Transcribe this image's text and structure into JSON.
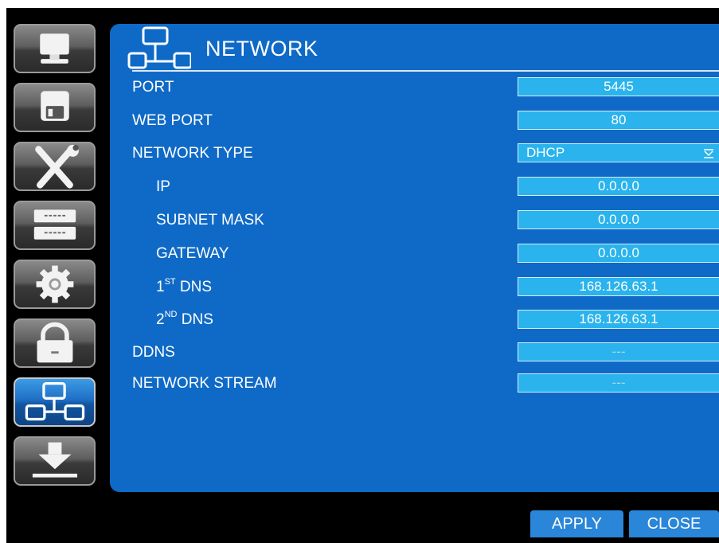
{
  "window": {
    "title": "NETWORK"
  },
  "sidebar": {
    "items": [
      {
        "name": "display",
        "icon": "monitor-icon"
      },
      {
        "name": "record",
        "icon": "floppy-disk-icon"
      },
      {
        "name": "devices",
        "icon": "tools-icon"
      },
      {
        "name": "storage",
        "icon": "hard-drive-icon"
      },
      {
        "name": "system",
        "icon": "gear-icon"
      },
      {
        "name": "security",
        "icon": "lock-icon"
      },
      {
        "name": "network",
        "icon": "network-icon",
        "active": true
      },
      {
        "name": "backup",
        "icon": "download-icon"
      }
    ]
  },
  "rows": {
    "port": {
      "label": "PORT",
      "value": "5445"
    },
    "web_port": {
      "label": "WEB PORT",
      "value": "80"
    },
    "network_type": {
      "label": "NETWORK TYPE",
      "value": "DHCP"
    },
    "ip": {
      "label": "IP",
      "value": "0.0.0.0"
    },
    "subnet_mask": {
      "label": "SUBNET MASK",
      "value": "0.0.0.0"
    },
    "gateway": {
      "label": "GATEWAY",
      "value": "0.0.0.0"
    },
    "dns1": {
      "label_num": "1",
      "label_sup": "ST",
      "label_rest": " DNS",
      "value": "168.126.63.1"
    },
    "dns2": {
      "label_num": "2",
      "label_sup": "ND",
      "label_rest": " DNS",
      "value": "168.126.63.1"
    },
    "ddns": {
      "label": "DDNS",
      "value": "---"
    },
    "network_stream": {
      "label": "NETWORK STREAM",
      "value": "---"
    }
  },
  "footer": {
    "apply_label": "APPLY",
    "close_label": "CLOSE"
  },
  "colors": {
    "panel": "#0f6ac7",
    "field": "#2ab3ec",
    "button": "#2a86d8",
    "background": "#000000"
  }
}
